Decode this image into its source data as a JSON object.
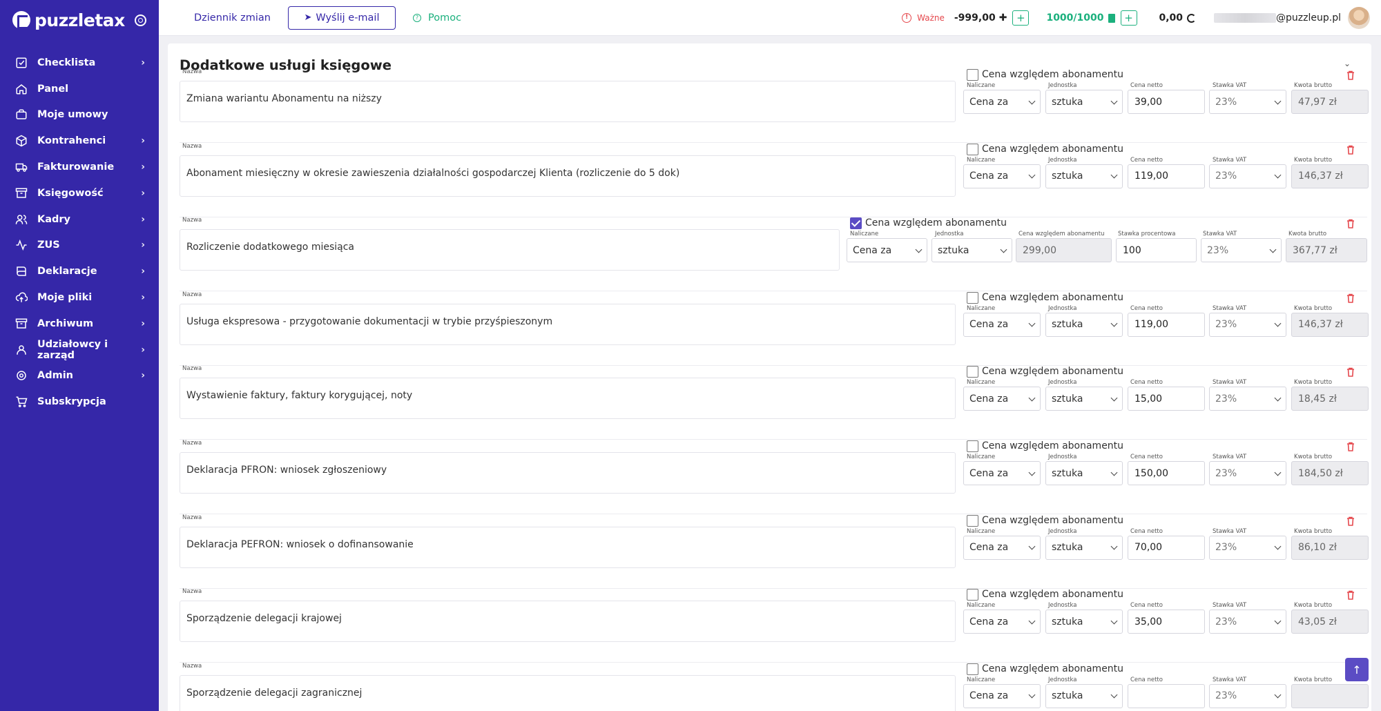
{
  "brand": {
    "name": "puzzletax"
  },
  "sidebar": {
    "items": [
      {
        "label": "Checklista",
        "icon": "checklist-icon",
        "has_children": true
      },
      {
        "label": "Panel",
        "icon": "home-icon",
        "has_children": false
      },
      {
        "label": "Moje umowy",
        "icon": "briefcase-icon",
        "has_children": false
      },
      {
        "label": "Kontrahenci",
        "icon": "box-icon",
        "has_children": true
      },
      {
        "label": "Fakturowanie",
        "icon": "truck-icon",
        "has_children": true
      },
      {
        "label": "Księgowość",
        "icon": "archive-icon",
        "has_children": true
      },
      {
        "label": "Kadry",
        "icon": "users-icon",
        "has_children": true
      },
      {
        "label": "ZUS",
        "icon": "activity-icon",
        "has_children": true
      },
      {
        "label": "Deklaracje",
        "icon": "book-icon",
        "has_children": true
      },
      {
        "label": "Moje pliki",
        "icon": "upload-cloud-icon",
        "has_children": true
      },
      {
        "label": "Archiwum",
        "icon": "archive-box-icon",
        "has_children": true
      },
      {
        "label": "Udziałowcy i zarząd",
        "icon": "user-icon",
        "has_children": true
      },
      {
        "label": "Admin",
        "icon": "settings-icon",
        "has_children": true
      },
      {
        "label": "Subskrypcja",
        "icon": "cart-icon",
        "has_children": false
      }
    ]
  },
  "topbar": {
    "changelog": "Dziennik zmian",
    "send_email": "Wyślij e-mail",
    "help": "Pomoc",
    "important": "Ważne",
    "balance": "-999,00",
    "docs_count": "1000/1000",
    "zero_value": "0,00",
    "email_domain": "@puzzleup.pl"
  },
  "page": {
    "title": "Dodatkowe usługi księgowe"
  },
  "labels": {
    "name": "Nazwa",
    "subscription_price": "Cena względem abonamentu",
    "charged": "Naliczane",
    "unit": "Jednostka",
    "net_price": "Cena netto",
    "vat_rate": "Stawka VAT",
    "gross_amount": "Kwota brutto",
    "sub_price_col": "Cena względem abonamentu",
    "percent_rate": "Stawka procentowa"
  },
  "services": [
    {
      "name": "Zmiana wariantu Abonamentu na niższy",
      "relative": false,
      "charged": "Cena za",
      "unit": "sztuka",
      "net": "39,00",
      "vat": "23%",
      "gross": "47,97 zł"
    },
    {
      "name": "Abonament miesięczny w okresie zawieszenia działalności gospodarczej Klienta (rozliczenie do 5 dok)",
      "relative": false,
      "charged": "Cena za",
      "unit": "sztuka",
      "net": "119,00",
      "vat": "23%",
      "gross": "146,37 zł"
    },
    {
      "name": "Rozliczenie dodatkowego miesiąca",
      "relative": true,
      "charged": "Cena za",
      "unit": "sztuka",
      "sub_price": "299,00",
      "percent": "100",
      "vat": "23%",
      "gross": "367,77 zł"
    },
    {
      "name": "Usługa ekspresowa - przygotowanie dokumentacji w trybie przyśpieszonym",
      "relative": false,
      "charged": "Cena za",
      "unit": "sztuka",
      "net": "119,00",
      "vat": "23%",
      "gross": "146,37 zł"
    },
    {
      "name": "Wystawienie faktury, faktury korygującej, noty",
      "relative": false,
      "charged": "Cena za",
      "unit": "sztuka",
      "net": "15,00",
      "vat": "23%",
      "gross": "18,45 zł"
    },
    {
      "name": "Deklaracja PFRON: wniosek zgłoszeniowy",
      "relative": false,
      "charged": "Cena za",
      "unit": "sztuka",
      "net": "150,00",
      "vat": "23%",
      "gross": "184,50 zł"
    },
    {
      "name": "Deklaracja PEFRON: wniosek o dofinansowanie",
      "relative": false,
      "charged": "Cena za",
      "unit": "sztuka",
      "net": "70,00",
      "vat": "23%",
      "gross": "86,10 zł"
    },
    {
      "name": "Sporządzenie delegacji krajowej",
      "relative": false,
      "charged": "Cena za",
      "unit": "sztuka",
      "net": "35,00",
      "vat": "23%",
      "gross": "43,05 zł"
    },
    {
      "name": "Sporządzenie delegacji zagranicznej",
      "relative": false,
      "charged": "Cena za",
      "unit": "sztuka",
      "net": "",
      "vat": "23%",
      "gross": ""
    }
  ],
  "icons": {
    "trash": "trash-icon",
    "scroll_top": "arrow-up-icon"
  },
  "colors": {
    "sidebar_bg": "#3527a8",
    "accent": "#5b4cc4",
    "success": "#1bb07d",
    "danger": "#e5484d"
  }
}
